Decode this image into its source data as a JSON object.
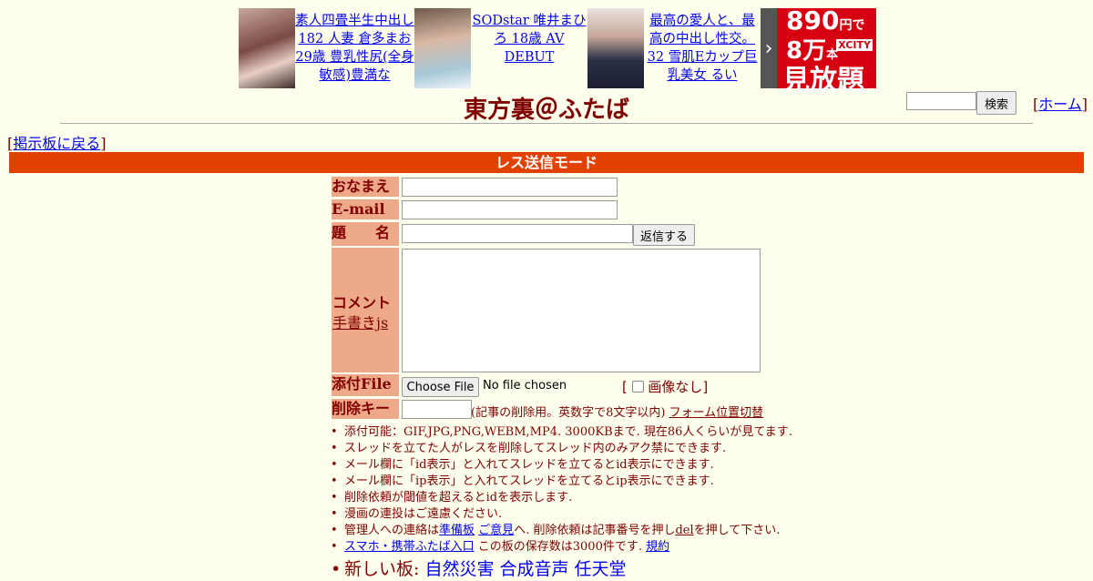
{
  "ads": [
    {
      "text": "素人四畳半生中出し182 人妻 倉多まお 29歳 豊乳性尻(全身敏感)豊満な"
    },
    {
      "text": "SODstar 唯井まひろ 18歳 AV DEBUT"
    },
    {
      "text": "最高の愛人と、最高の中出し性交。 32 雪肌Eカップ巨乳美女 るい"
    }
  ],
  "banner": {
    "line1_num": "890",
    "line1_unit": "円で",
    "line2_num": "8万",
    "line2_unit": "本",
    "brand": "XCITY",
    "line3": "見放題",
    "arrow": "›"
  },
  "header": {
    "title": "東方裏＠ふたば",
    "search_button": "検索",
    "home_link": "ホーム",
    "back_link": "掲示板に戻る"
  },
  "mode_bar": "レス送信モード",
  "form": {
    "name_label": "おなまえ",
    "email_label": "E-mail",
    "subject_label": "題　　名",
    "submit_button": "返信する",
    "comment_label": "コメント",
    "handwriting_link": "手書きjs",
    "file_label": "添付File",
    "file_button": "Choose File",
    "file_status": "No file chosen",
    "no_image_label": "画像なし",
    "delete_key_label": "削除キー",
    "delete_key_note": "(記事の削除用。英数字で8文字以内)",
    "form_position_link": "フォーム位置切替"
  },
  "notes": [
    "添付可能：GIF,JPG,PNG,WEBM,MP4. 3000KBまで. 現在86人くらいが見てます.",
    "スレッドを立てた人がレスを削除してスレッド内のみアク禁にできます.",
    "メール欄に「id表示」と入れてスレッドを立てるとid表示にできます.",
    "メール欄に「ip表示」と入れてスレッドを立てるとip表示にできます.",
    "削除依頼が閾値を超えるとidを表示します.",
    "漫画の連投はご遠慮ください."
  ],
  "note_admin": {
    "pre": "管理人への連絡は",
    "link1": "準備板",
    "link2": "ご意見",
    "mid": "へ. 削除依頼は記事番号を押し",
    "del": "del",
    "post": "を押して下さい."
  },
  "note_mobile": {
    "link": "スマホ・携帯ふたば入口",
    "text": " この板の保存数は3000件です. ",
    "rules": "規約"
  },
  "note_new": {
    "label": "新しい板: ",
    "boards": "自然災害 合成音声 任天堂"
  }
}
